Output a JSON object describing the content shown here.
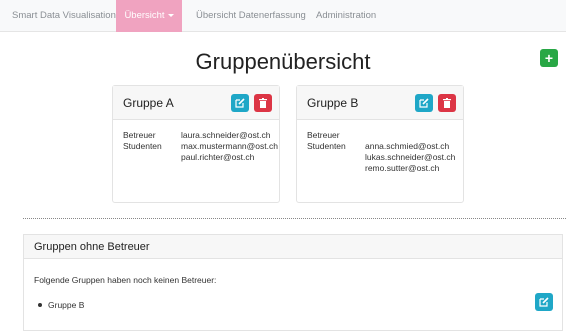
{
  "navbar": {
    "brand": "Smart Data Visualisation",
    "items": [
      {
        "label": "Übersicht",
        "active": true
      },
      {
        "label": "Übersicht Datenerfassung",
        "active": false
      },
      {
        "label": "Administration",
        "active": false
      }
    ]
  },
  "page": {
    "title": "Gruppenübersicht",
    "add_button_label": "+"
  },
  "groups": [
    {
      "name": "Gruppe A",
      "betreuer_label": "Betreuer",
      "betreuer": [
        "laura.schneider@ost.ch"
      ],
      "studenten_label": "Studenten",
      "studenten": [
        "max.mustermann@ost.ch",
        "paul.richter@ost.ch"
      ]
    },
    {
      "name": "Gruppe B",
      "betreuer_label": "Betreuer",
      "betreuer": [],
      "studenten_label": "Studenten",
      "studenten": [
        "anna.schmied@ost.ch",
        "lukas.schneider@ost.ch",
        "remo.sutter@ost.ch"
      ]
    }
  ],
  "unassigned": {
    "title": "Gruppen ohne Betreuer",
    "text": "Folgende Gruppen haben noch keinen Betreuer:",
    "items": [
      "Gruppe B"
    ]
  },
  "colors": {
    "nav_active": "#f0a3c0",
    "add_button": "#28a745",
    "edit_button": "#1fa7c7",
    "delete_button": "#dc3545"
  },
  "icons": {
    "edit": "edit-icon",
    "delete": "trash-icon",
    "add": "plus-icon",
    "dropdown": "caret-down-icon"
  }
}
